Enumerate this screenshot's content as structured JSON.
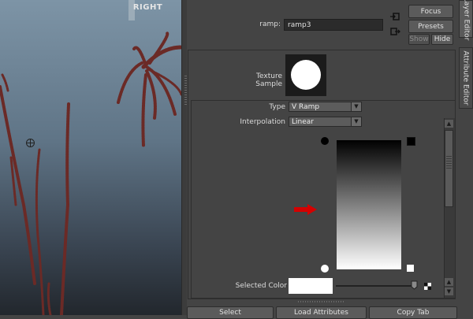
{
  "viewport": {
    "camera_label": "RIGHT"
  },
  "header": {
    "node_label": "ramp:",
    "node_value": "ramp3",
    "focus_label": "Focus",
    "presets_label": "Presets",
    "show_label": "Show",
    "hide_label": "Hide"
  },
  "side_tabs": {
    "layer_editor": "Layer Editor",
    "attribute_editor": "Attribute Editor"
  },
  "texture": {
    "label": "Texture Sample"
  },
  "ramp": {
    "type_label": "Type",
    "type_value": "V Ramp",
    "interpolation_label": "Interpolation",
    "interpolation_value": "Linear",
    "selected_color_label": "Selected Color",
    "selected_color": "#ffffff",
    "gradient_top_color": "#000000",
    "gradient_bottom_color": "#ffffff"
  },
  "bottom_buttons": {
    "select": "Select",
    "load_attributes": "Load Attributes",
    "copy_tab": "Copy Tab"
  },
  "colors": {
    "panel_bg": "#444444",
    "annotation_arrow": "#d40000",
    "particle_color": "#6b2a26"
  }
}
